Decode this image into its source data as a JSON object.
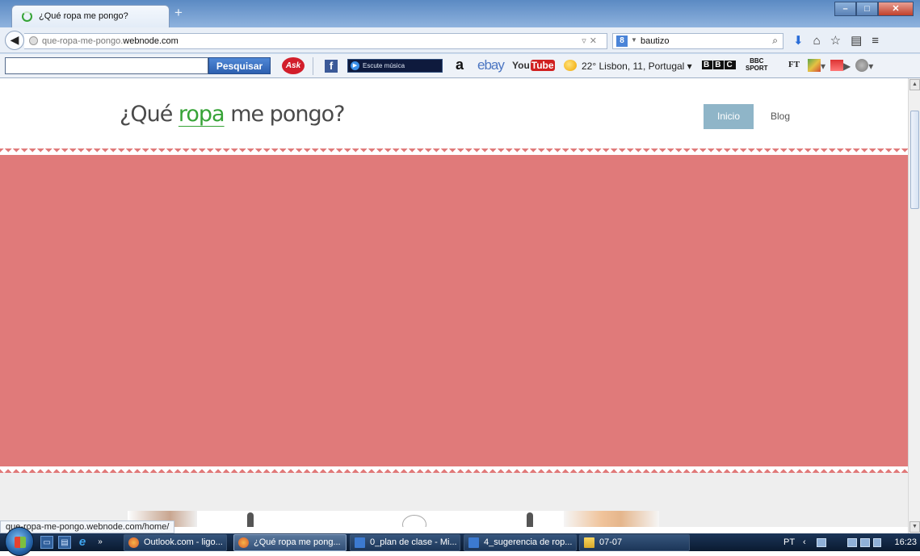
{
  "browser": {
    "tab_title": "¿Qué ropa me pongo?",
    "new_tab_label": "+",
    "url_prefix": "que-ropa-me-pongo.",
    "url_domain": "webnode.com",
    "url_rest": "",
    "search_value": "bautizo",
    "search_engine_icon": "google-icon",
    "window_controls": [
      "minimize",
      "maximize",
      "close"
    ]
  },
  "toolbar": {
    "search_button": "Pesquisar",
    "ask_label": "Ask",
    "music_label": "Escute música",
    "amazon_label": "a",
    "ebay_label": "ebay",
    "youtube_you": "You",
    "youtube_tube": "Tube",
    "weather": "22° Lisbon, 11, Portugal ▾",
    "bbc_letters": [
      "B",
      "B",
      "C"
    ],
    "bbc_sport_top": "BBC",
    "bbc_sport_bottom": "SPORT",
    "ft_label": "FT"
  },
  "site": {
    "logo_pre": "¿Qué ",
    "logo_accent": "ropa",
    "logo_post": " me pongo?",
    "nav": [
      {
        "label": "Inicio",
        "active": true
      },
      {
        "label": "Blog",
        "active": false
      }
    ],
    "banner_color": "#e07a7a",
    "accent_color": "#36a336",
    "nav_active_color": "#8fb5c8"
  },
  "status": {
    "hover_url": "que-ropa-me-pongo.webnode.com/home/"
  },
  "taskbar": {
    "items": [
      {
        "label": "Outlook.com - ligo...",
        "icon": "firefox-icon",
        "active": false
      },
      {
        "label": "¿Qué ropa me pong...",
        "icon": "firefox-icon",
        "active": true
      },
      {
        "label": "0_plan de clase - Mi...",
        "icon": "word-icon",
        "active": false
      },
      {
        "label": "4_sugerencia de rop...",
        "icon": "word-icon",
        "active": false
      },
      {
        "label": "07-07",
        "icon": "folder-icon",
        "active": false
      }
    ],
    "language": "PT",
    "time": "16:23"
  }
}
